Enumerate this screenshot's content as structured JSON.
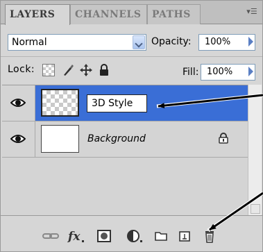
{
  "tabs": [
    {
      "label": "LAYERS",
      "active": true
    },
    {
      "label": "CHANNELS",
      "active": false
    },
    {
      "label": "PATHS",
      "active": false
    }
  ],
  "panel_menu_icon": "panel-menu-icon",
  "blend_mode": {
    "value": "Normal"
  },
  "opacity": {
    "label": "Opacity:",
    "value": "100%"
  },
  "lock": {
    "label": "Lock:",
    "icons": [
      "lock-transparent-icon",
      "lock-image-icon",
      "lock-position-icon",
      "lock-all-icon"
    ]
  },
  "fill": {
    "label": "Fill:",
    "value": "100%"
  },
  "layers": [
    {
      "name": "3D Style",
      "selected": true,
      "visible": true,
      "editing": true
    },
    {
      "name": "Background",
      "selected": false,
      "visible": true,
      "locked": true
    }
  ],
  "bottom_tools": [
    "link-layers-icon",
    "layer-style-fx-icon",
    "add-mask-icon",
    "adjustment-layer-icon",
    "new-group-icon",
    "new-layer-icon",
    "delete-layer-icon"
  ],
  "colors": {
    "selected_row": "#3a6ed6",
    "panel_bg": "#d6d6d6",
    "annotation_arrow": "#000000"
  }
}
